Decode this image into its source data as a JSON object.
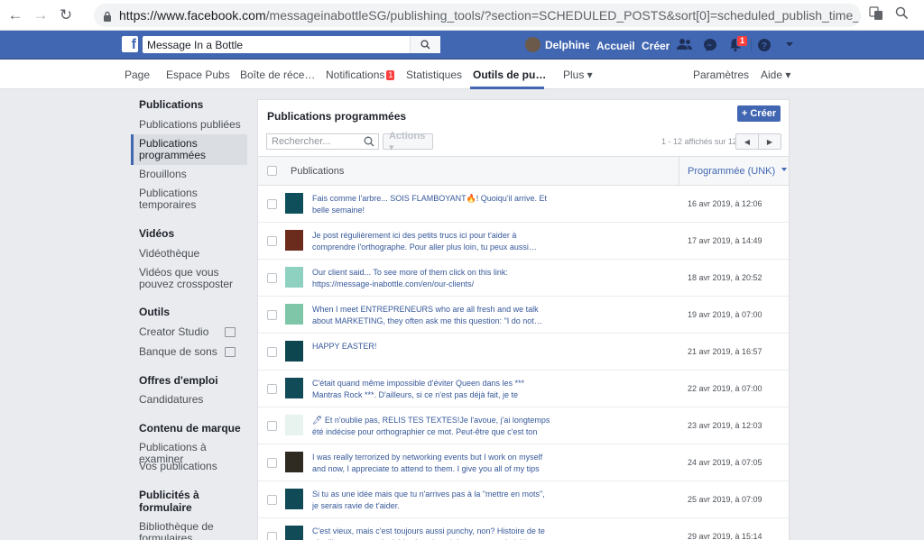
{
  "browser": {
    "url_host": "https://www.facebook.com",
    "url_path": "/messageinabottleSG/publishing_tools/?section=SCHEDULED_POSTS&sort[0]=scheduled_publish_time_ascending"
  },
  "topbar": {
    "search_value": "Message In a Bottle",
    "user_name": "Delphine",
    "home_label": "Accueil",
    "create_label": "Créer",
    "notif_count": "1"
  },
  "pagenav": {
    "items": [
      "Page",
      "Espace Pubs",
      "Boîte de réce…",
      "Notifications",
      "Statistiques",
      "Outils de pu…",
      "Plus ▾",
      "Paramètres",
      "Aide ▾"
    ],
    "notif_badge": "1"
  },
  "sidebar": {
    "sec_publications": "Publications",
    "pub_published": "Publications publiées",
    "pub_scheduled": "Publications programmées",
    "pub_drafts": "Brouillons",
    "pub_temporary": "Publications temporaires",
    "sec_videos": "Vidéos",
    "video_library": "Vidéothèque",
    "video_crosspost": "Vidéos que vous pouvez crossposter",
    "sec_tools": "Outils",
    "tool_creator": "Creator Studio",
    "tool_sounds": "Banque de sons",
    "sec_jobs": "Offres d'emploi",
    "jobs_applications": "Candidatures",
    "sec_brand": "Contenu de marque",
    "brand_review": "Publications à examiner",
    "brand_yours": "Vos publications",
    "sec_leads": "Publicités à formulaire",
    "leads_library": "Bibliothèque de formulaires"
  },
  "panel": {
    "title": "Publications programmées",
    "create_label": "+ Créer",
    "search_placeholder": "Rechercher...",
    "actions_label": "Actions ▾",
    "count_text": "1 - 12 affichés sur 12",
    "col_publications": "Publications",
    "col_scheduled": "Programmée (UNK)"
  },
  "rows": [
    {
      "text": "Fais comme l'arbre... SOIS FLAMBOYANT🔥! Quoiqu'il arrive. Et belle semaine!",
      "date": "16 avr 2019, à 12:06",
      "thumb_color": "#0f4f5c"
    },
    {
      "text": "Je post régulièrement ici des petits trucs ici pour t'aider à comprendre l'orthographe. Pour aller plus loin, tu peux aussi…",
      "date": "17 avr 2019, à 14:49",
      "thumb_color": "#6b2c1e"
    },
    {
      "text": "Our client said... To see more of them click on this link: https://message-inabottle.com/en/our-clients/",
      "date": "18 avr 2019, à 20:52",
      "thumb_color": "#8fd1c0"
    },
    {
      "text": "When I meet ENTREPRENEURS who are all fresh and we talk about MARKETING, they often ask me this question: \"I do not…",
      "date": "19 avr 2019, à 07:00",
      "thumb_color": "#7fc6a8"
    },
    {
      "text": "HAPPY EASTER!",
      "date": "21 avr 2019, à 16:57",
      "thumb_color": "#0e4650"
    },
    {
      "text": "C'était quand même impossible d'éviter Queen dans les *** Mantras Rock ***. D'ailleurs, si ce n'est pas déjà fait, je te consei…",
      "date": "22 avr 2019, à 07:00",
      "thumb_color": "#114b57"
    },
    {
      "text": "🖊 Et n'oublie pas, RELIS TES TEXTES!Je l'avoue, j'ai longtemps été indécise pour orthographier ce mot. Peut-être que c'est ton c…",
      "date": "23 avr 2019, à 12:03",
      "thumb_color": "#e8f2ee"
    },
    {
      "text": "I was really terrorized by networking events but I work on myself and now, I appreciate to attend to them. I give you all of my tips t…",
      "date": "24 avr 2019, à 07:05",
      "thumb_color": "#2f2a22"
    },
    {
      "text": "Si tu as une idée mais que tu n'arrives pas à la \"mettre en mots\", je serais ravie de t'aider.",
      "date": "25 avr 2019, à 07:09",
      "thumb_color": "#0f4a56"
    },
    {
      "text": "C'est vieux, mais c'est toujours aussi punchy, non? Histoire de te réveiller un peu et de t'aider à maintenir le cap, on a choisi les…",
      "date": "29 avr 2019, à 15:14",
      "thumb_color": "#114b57"
    }
  ]
}
